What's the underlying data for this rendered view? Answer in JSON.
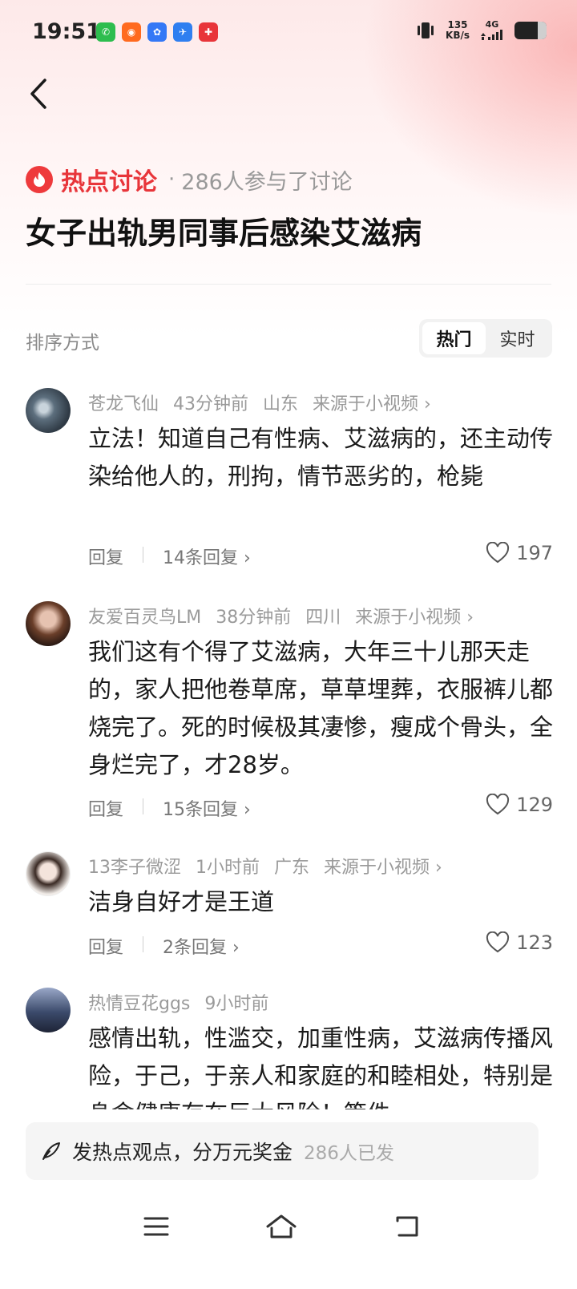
{
  "status_bar": {
    "time": "19:51",
    "net_speed_value": "135",
    "net_speed_unit": "KB/s",
    "network_type": "4G",
    "app_icons": [
      "wechat-icon",
      "taobao-icon",
      "baidu-map-icon",
      "browser-icon",
      "pinduoduo-icon"
    ]
  },
  "header": {
    "tag_label": "热点讨论",
    "participants": "286人参与了讨论",
    "title": "女子出轨男同事后感染艾滋病"
  },
  "sort": {
    "label": "排序方式",
    "options": [
      "热门",
      "实时"
    ],
    "selected": "热门"
  },
  "comments": [
    {
      "user": "苍龙飞仙",
      "time": "43分钟前",
      "location": "山东",
      "source": "来源于小视频",
      "text": "立法！知道自己有性病、艾滋病的，还主动传染给他人的，刑拘，情节恶劣的，枪毙",
      "reply_label": "回复",
      "reply_count": "14条回复",
      "likes": "197"
    },
    {
      "user": "友爱百灵鸟LM",
      "time": "38分钟前",
      "location": "四川",
      "source": "来源于小视频",
      "text": "我们这有个得了艾滋病，大年三十儿那天走的，家人把他卷草席，草草埋葬，衣服裤儿都烧完了。死的时候极其凄惨，瘦成个骨头，全身烂完了，才28岁。",
      "reply_label": "回复",
      "reply_count": "15条回复",
      "likes": "129"
    },
    {
      "user": "13李子微涩",
      "time": "1小时前",
      "location": "广东",
      "source": "来源于小视频",
      "text": "洁身自好才是王道",
      "reply_label": "回复",
      "reply_count": "2条回复",
      "likes": "123"
    },
    {
      "user": "热情豆花ggs",
      "time": "9小时前",
      "text": "感情出轨，性滥交，加重性病，艾滋病传播风险，于己，于亲人和家庭的和睦相处，特别是身命健康存在巨大风险！策件"
    }
  ],
  "compose": {
    "prompt": "发热点观点，分万元奖金",
    "count": "286人已发"
  },
  "colors": {
    "accent": "#e8353a",
    "meta_text": "#9a9a9a"
  }
}
